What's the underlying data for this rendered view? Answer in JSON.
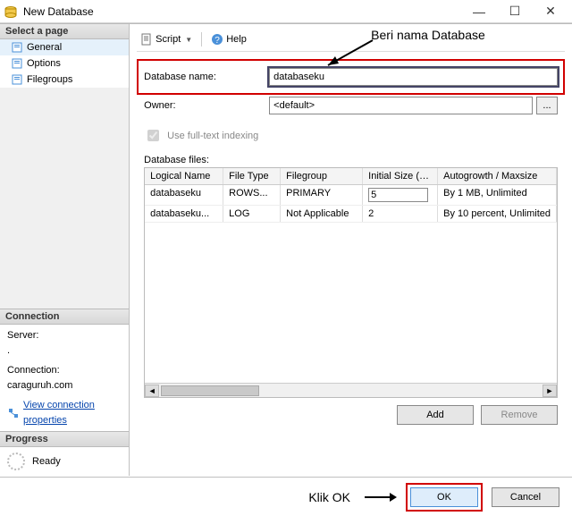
{
  "window": {
    "title": "New Database",
    "min": "—",
    "max": "☐",
    "close": "✕"
  },
  "sidebar": {
    "select_page": "Select a page",
    "pages": [
      {
        "label": "General",
        "icon": "page-icon"
      },
      {
        "label": "Options",
        "icon": "page-icon"
      },
      {
        "label": "Filegroups",
        "icon": "page-icon"
      }
    ],
    "connection_title": "Connection",
    "server_label": "Server:",
    "server_value": ".",
    "conn_label": "Connection:",
    "conn_value": "caraguruh.com",
    "view_props": "View connection properties",
    "progress_title": "Progress",
    "progress_value": "Ready"
  },
  "toolbar": {
    "script": "Script",
    "help": "Help"
  },
  "form": {
    "db_name_label": "Database name:",
    "db_name_value": "databaseku",
    "owner_label": "Owner:",
    "owner_value": "<default>",
    "browse": "...",
    "fulltext": "Use full-text indexing",
    "files_label": "Database files:"
  },
  "grid": {
    "columns": [
      "Logical Name",
      "File Type",
      "Filegroup",
      "Initial Size (MB)",
      "Autogrowth / Maxsize"
    ],
    "rows": [
      {
        "name": "databaseku",
        "type": "ROWS...",
        "fg": "PRIMARY",
        "size": "5",
        "grow": "By 1 MB, Unlimited"
      },
      {
        "name": "databaseku...",
        "type": "LOG",
        "fg": "Not Applicable",
        "size": "2",
        "grow": "By 10 percent, Unlimited"
      }
    ]
  },
  "buttons": {
    "add": "Add",
    "remove": "Remove",
    "ok": "OK",
    "cancel": "Cancel"
  },
  "annotations": {
    "beri_nama": "Beri nama Database",
    "klik_ok": "Klik OK"
  }
}
